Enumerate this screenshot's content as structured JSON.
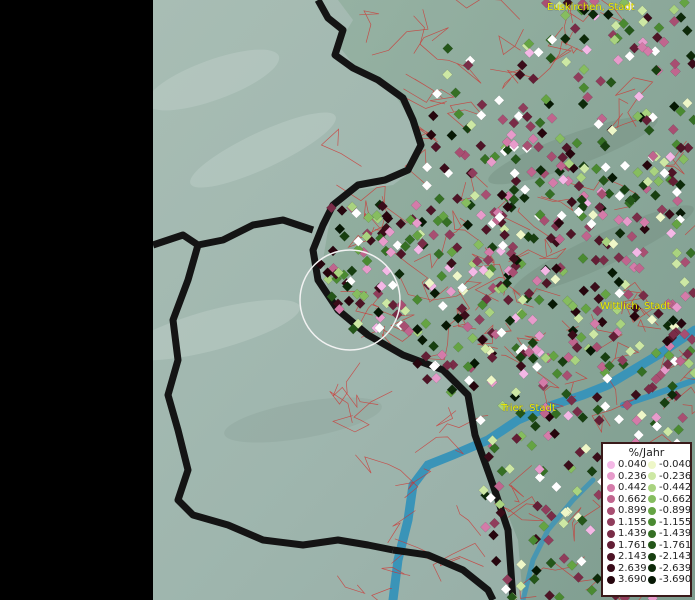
{
  "map": {
    "legend": {
      "title": "%/Jahr",
      "positive": [
        {
          "label": "0.040",
          "color": "#f4b8e6"
        },
        {
          "label": "0.236",
          "color": "#e79bcb"
        },
        {
          "label": "0.442",
          "color": "#d47ba9"
        },
        {
          "label": "0.662",
          "color": "#c0658e"
        },
        {
          "label": "0.899",
          "color": "#a84f72"
        },
        {
          "label": "1.155",
          "color": "#903d5c"
        },
        {
          "label": "1.439",
          "color": "#792c47"
        },
        {
          "label": "1.761",
          "color": "#631e35"
        },
        {
          "label": "2.143",
          "color": "#4e1426"
        },
        {
          "label": "2.639",
          "color": "#3a0c19"
        },
        {
          "label": "3.690",
          "color": "#26050d"
        }
      ],
      "negative": [
        {
          "label": "-0.040",
          "color": "#eef7c8"
        },
        {
          "label": "-0.236",
          "color": "#cde8a4"
        },
        {
          "label": "-0.442",
          "color": "#a9d37f"
        },
        {
          "label": "-0.662",
          "color": "#86bd5f"
        },
        {
          "label": "-0.899",
          "color": "#65a443"
        },
        {
          "label": "-1.155",
          "color": "#4a8a31"
        },
        {
          "label": "-1.439",
          "color": "#356f24"
        },
        {
          "label": "-1.761",
          "color": "#245619"
        },
        {
          "label": "-2.143",
          "color": "#173f10"
        },
        {
          "label": "-2.639",
          "color": "#0d2a09"
        },
        {
          "label": "-3.690",
          "color": "#061804"
        }
      ]
    },
    "places": [
      {
        "name": "Euskirchen, Stadt"
      },
      {
        "name": "Wittlich, Stadt"
      },
      {
        "name": "Trier, Stadt"
      }
    ]
  }
}
